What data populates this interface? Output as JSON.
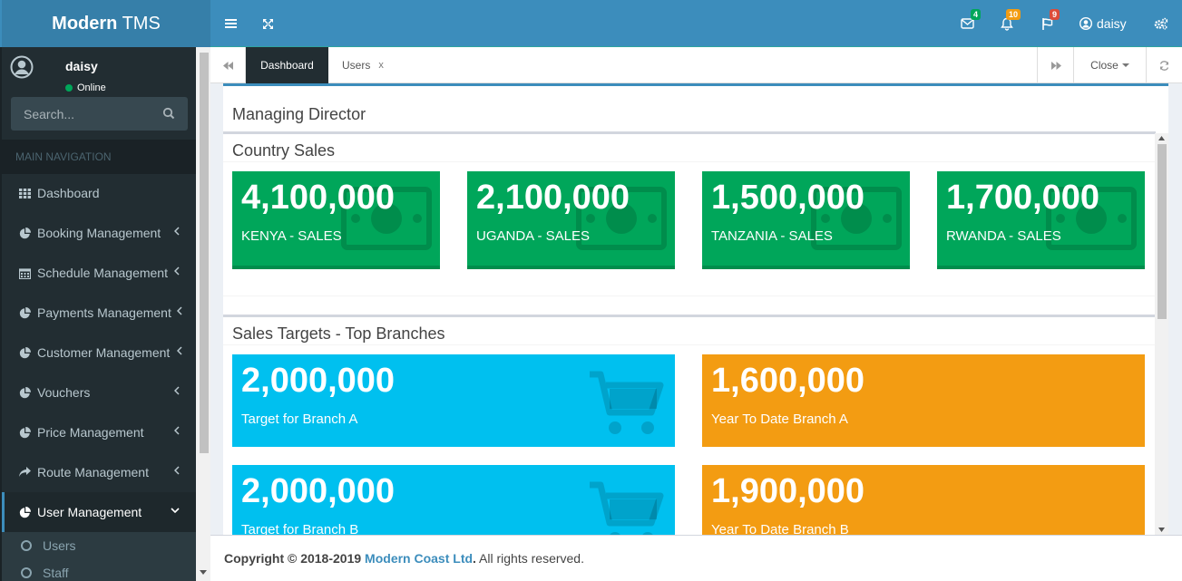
{
  "header": {
    "logo_bold": "Modern",
    "logo_rest": " TMS",
    "icons": {
      "menu": "bars-icon",
      "fullscreen": "arrows-expand-icon",
      "mail": "envelope-icon",
      "bell": "bell-icon",
      "flag": "flag-icon",
      "settings": "cogs-icon"
    },
    "mail_count": "4",
    "notif_count": "10",
    "task_count": "9",
    "username": "daisy"
  },
  "sidebar": {
    "username": "daisy",
    "status": "Online",
    "search_placeholder": "Search...",
    "nav_header": "MAIN NAVIGATION",
    "items": [
      {
        "label": "Dashboard",
        "icon": "dashboard-icon"
      },
      {
        "label": "Booking Management",
        "icon": "pie-chart-icon"
      },
      {
        "label": "Schedule Management",
        "icon": "calendar-icon"
      },
      {
        "label": "Payments Management",
        "icon": "pie-chart-icon"
      },
      {
        "label": "Customer Management",
        "icon": "pie-chart-icon"
      },
      {
        "label": "Vouchers",
        "icon": "pie-chart-icon"
      },
      {
        "label": "Price Management",
        "icon": "pie-chart-icon"
      },
      {
        "label": "Route Management",
        "icon": "share-icon"
      },
      {
        "label": "User Management",
        "icon": "pie-chart-icon"
      }
    ],
    "subitems": [
      "Users",
      "Staff"
    ]
  },
  "tabs": {
    "items": [
      {
        "label": "Dashboard"
      },
      {
        "label": "Users",
        "close": "x"
      }
    ],
    "close_label": "Close"
  },
  "content": {
    "title": "Managing Director",
    "country_sales": {
      "title": "Country Sales",
      "tiles": [
        {
          "value": "4,100,000",
          "label": "KENYA - SALES"
        },
        {
          "value": "2,100,000",
          "label": "UGANDA - SALES"
        },
        {
          "value": "1,500,000",
          "label": "TANZANIA - SALES"
        },
        {
          "value": "1,700,000",
          "label": "RWANDA - SALES"
        }
      ]
    },
    "sales_targets": {
      "title": "Sales Targets - Top Branches",
      "tiles": [
        {
          "value": "2,000,000",
          "label": "Target for Branch A"
        },
        {
          "value": "1,600,000",
          "label": "Year To Date Branch A"
        },
        {
          "value": "2,000,000",
          "label": "Target for Branch B"
        },
        {
          "value": "1,900,000",
          "label": "Year To Date Branch B"
        }
      ]
    }
  },
  "footer": {
    "prefix": "Copyright © 2018-2019 ",
    "company": "Modern Coast Ltd",
    "dot": ".",
    "suffix": " All rights reserved."
  },
  "colors": {
    "primary": "#3c8dbc",
    "green": "#00a65a",
    "aqua": "#00c0ef",
    "orange": "#f39c12",
    "sidebar": "#222d32"
  }
}
